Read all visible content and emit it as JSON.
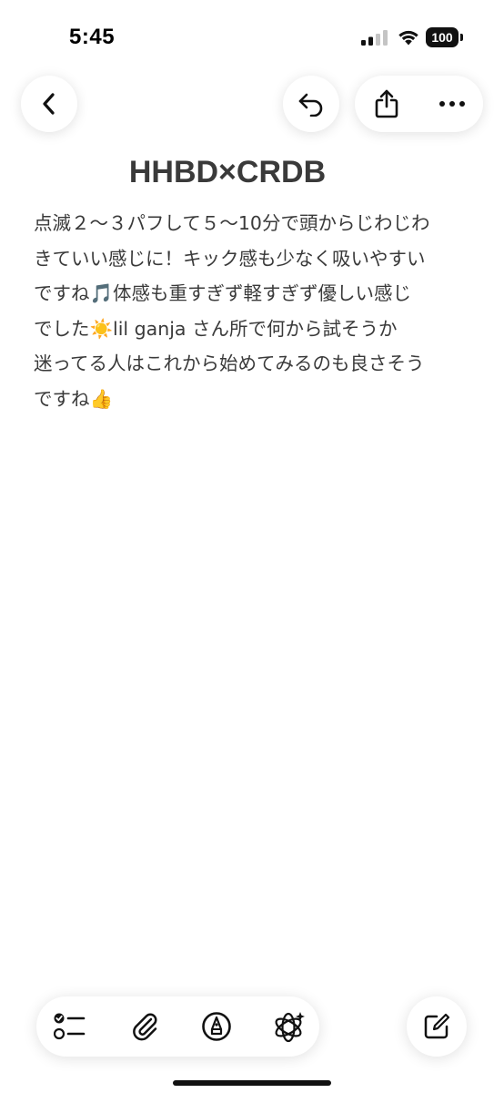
{
  "status_bar": {
    "time": "5:45",
    "battery": "100",
    "signal_icon": "cellular-signal-icon",
    "wifi_icon": "wifi-icon"
  },
  "toolbar_top": {
    "back": "chevron-left-icon",
    "undo": "undo-icon",
    "share": "share-icon",
    "more": "ellipsis-icon"
  },
  "note": {
    "title": "HHBD×CRDB",
    "lines": [
      "点滅２〜３パフして５〜10分で頭からじわじわ",
      "きていい感じに！キック感も少なく吸いやすい",
      "ですね🎵体感も重すぎず軽すぎず優しい感じ",
      "でした☀️lil ganja さん所で何から試そうか",
      "迷ってる人はこれから始めてみるのも良さそう",
      "ですね👍"
    ]
  },
  "toolbar_bottom": {
    "checklist": "checklist-icon",
    "attach": "paperclip-icon",
    "markup": "markup-pen-icon",
    "ai": "writing-tools-icon",
    "compose": "compose-icon"
  },
  "colors": {
    "text": "#3a3a3a",
    "background": "#ffffff"
  }
}
